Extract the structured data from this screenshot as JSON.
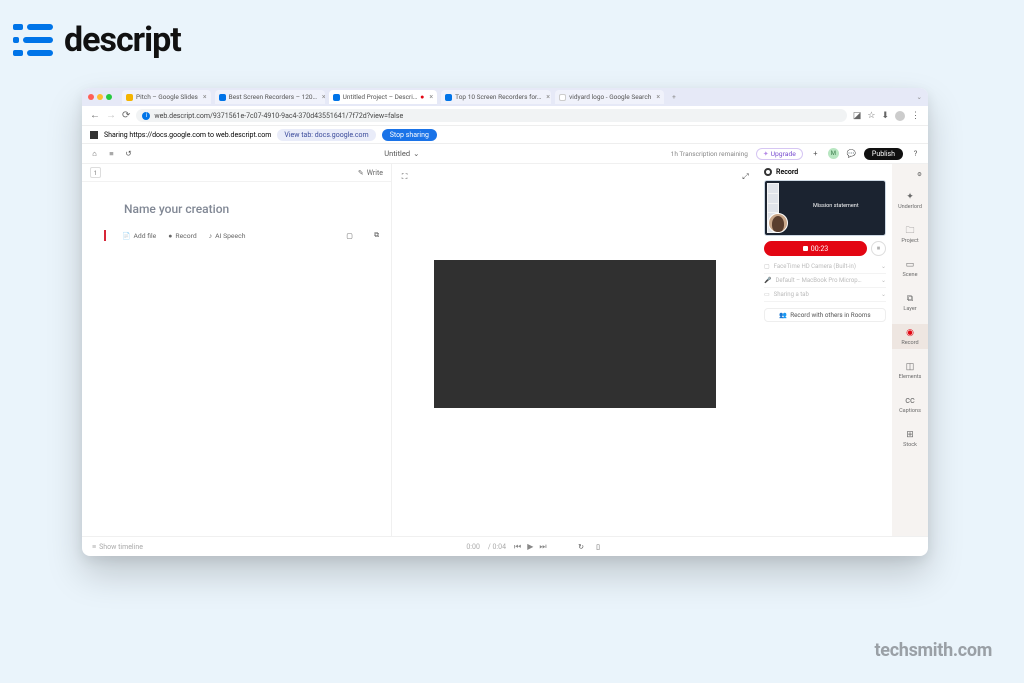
{
  "brand": {
    "name": "descript",
    "footer": "techsmith.com"
  },
  "tabs": [
    {
      "label": "Pitch – Google Slides",
      "color": "#f4b400"
    },
    {
      "label": "Best Screen Recorders – 120…",
      "color": "#0074e8"
    },
    {
      "label": "Untitled Project – Descri…",
      "color": "#0074e8",
      "active": true,
      "rec": true
    },
    {
      "label": "Top 10 Screen Recorders for…",
      "color": "#0074e8"
    },
    {
      "label": "vidyard logo - Google Search",
      "color": "#9aa0a6"
    }
  ],
  "address": {
    "url": "web.descript.com/9371561e-7c07-4910-9ac4-370d43551641/7f72d?view=false"
  },
  "share_banner": {
    "text": "Sharing https://docs.google.com to web.descript.com",
    "view_tab": "View tab: docs.google.com",
    "stop": "Stop sharing"
  },
  "project": {
    "title": "Untitled",
    "transcription": "1h Transcription remaining",
    "upgrade": "Upgrade",
    "avatar": "M",
    "publish": "Publish"
  },
  "left": {
    "scene_num": "1",
    "write": "Write",
    "title_placeholder": "Name your creation",
    "add_file": "Add file",
    "record": "Record",
    "ai_speech": "AI Speech"
  },
  "record": {
    "header": "Record",
    "preview_label": "Mission statement",
    "timer": "00:23",
    "camera": "FaceTime HD Camera (Built-in)",
    "mic": "Default – MacBook Pro Microp…",
    "screen": "Sharing a tab",
    "rooms": "Record with others in Rooms"
  },
  "rail": {
    "underlord": "Underlord",
    "project": "Project",
    "scene": "Scene",
    "layer": "Layer",
    "record": "Record",
    "elements": "Elements",
    "captions": "Captions",
    "stock": "Stock"
  },
  "timeline": {
    "show": "Show timeline",
    "time": "0:00",
    "dur": "/ 0:04"
  }
}
